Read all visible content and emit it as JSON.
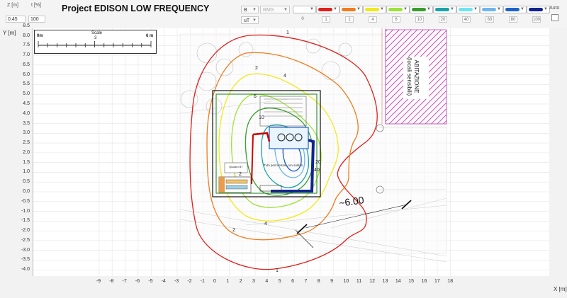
{
  "app": {
    "title": "Project EDISON LOW FREQUENCY"
  },
  "fields": {
    "z_label": "Z [m]",
    "z_value": "0.45",
    "t_label": "t [%]",
    "t_value": "100"
  },
  "dropdowns": {
    "field_type": "B",
    "unit": "uT",
    "mode": "RMS"
  },
  "palette": [
    {
      "color": "#ffffff",
      "threshold": "0",
      "thr_shown": false
    },
    {
      "color": "#e0201b",
      "threshold": "1",
      "thr_shown": true
    },
    {
      "color": "#f07c1e",
      "threshold": "2",
      "thr_shown": true
    },
    {
      "color": "#f2e81e",
      "threshold": "4",
      "thr_shown": true
    },
    {
      "color": "#9de23a",
      "threshold": "6",
      "thr_shown": true
    },
    {
      "color": "#3a9d2e",
      "threshold": "10",
      "thr_shown": true
    },
    {
      "color": "#1aa3a8",
      "threshold": "20",
      "thr_shown": true
    },
    {
      "color": "#6fe3ef",
      "threshold": "40",
      "thr_shown": true
    },
    {
      "color": "#6fb6f0",
      "threshold": "60",
      "thr_shown": true
    },
    {
      "color": "#1d62c9",
      "threshold": "80",
      "thr_shown": true
    },
    {
      "color": "#10248f",
      "threshold": "100",
      "thr_shown": true
    }
  ],
  "auto": {
    "label": "Auto",
    "checked": false
  },
  "axes": {
    "y_label": "Y [m]",
    "x_label": "X [m]",
    "y_ticks": [
      "8.5",
      "8.0",
      "7.5",
      "7.0",
      "6.5",
      "6.0",
      "5.5",
      "5.0",
      "4.5",
      "4.0",
      "3.5",
      "3.0",
      "2.5",
      "2.0",
      "1.5",
      "1.0",
      "0.5",
      "0.0",
      "-0.5",
      "-1.0",
      "-1.5",
      "-2.0",
      "-2.5",
      "-3.0",
      "-3.5",
      "-4.0"
    ],
    "x_ticks": [
      "-9",
      "-8",
      "-7",
      "-6",
      "-5",
      "-4",
      "-3",
      "-2",
      "-1",
      "0",
      "1",
      "2",
      "3",
      "4",
      "5",
      "6",
      "7",
      "8",
      "9",
      "10",
      "11",
      "12",
      "13",
      "14",
      "15",
      "16",
      "17",
      "18"
    ]
  },
  "scale": {
    "title": "Scale",
    "left": "0m",
    "mid": "3",
    "right": "6 m"
  },
  "annotations": {
    "distance": "~6.00",
    "building_line1": "ABITAZIONE",
    "building_line2": "(locali sensibili)",
    "cabin_label": "Tubi perimetrale\ncon\nsaldati",
    "panel_label": "Quadro\nBT"
  },
  "contour_labels": {
    "outer": "1",
    "mid": "2",
    "inner": "4",
    "inner6": "6",
    "inner10": "10",
    "inner20": "20",
    "inner40": "40"
  }
}
